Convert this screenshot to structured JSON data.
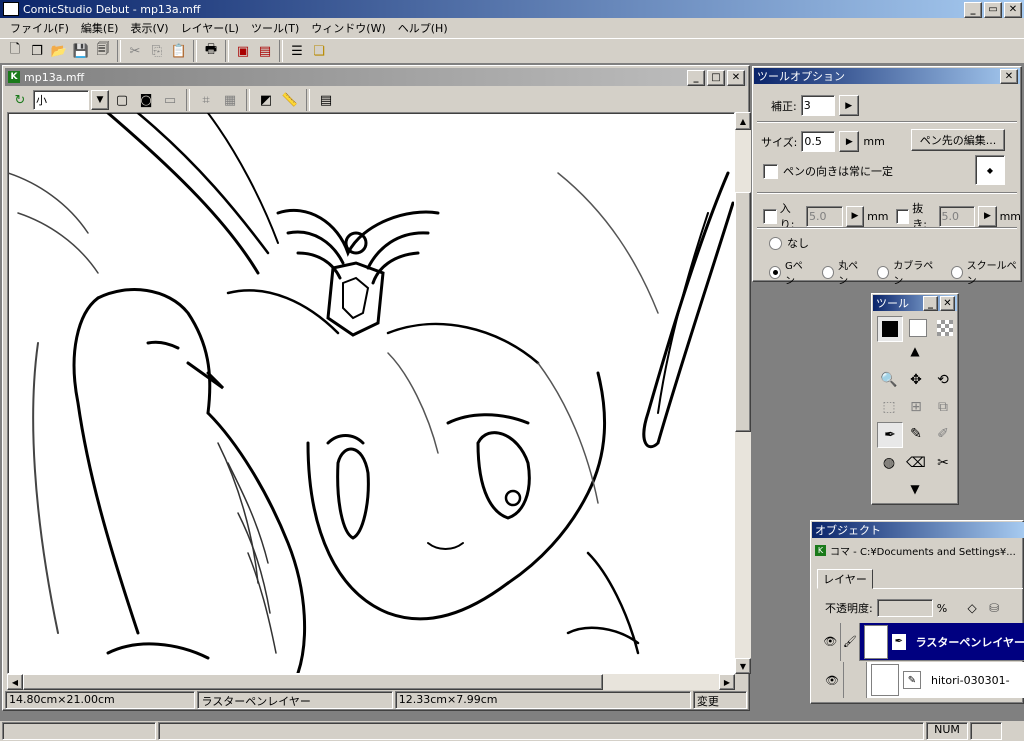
{
  "app": {
    "title": "ComicStudio Debut - mp13a.mff"
  },
  "menu": [
    "ファイル(F)",
    "編集(E)",
    "表示(V)",
    "レイヤー(L)",
    "ツール(T)",
    "ウィンドウ(W)",
    "ヘルプ(H)"
  ],
  "toolbar": {
    "icons": [
      "new-page-icon",
      "new-story-icon",
      "open-folder-icon",
      "save-icon",
      "save-all-icon",
      "cut-icon",
      "copy-icon",
      "paste-icon",
      "print-icon",
      "export-icon",
      "export-image-icon",
      "page-manager-icon",
      "story-icon"
    ]
  },
  "doc": {
    "title": "mp13a.mff",
    "zoom_value": "小",
    "status_size": "14.80cm×21.00cm",
    "status_layer": "ラスターペンレイヤー",
    "status_coord": "12.33cm×7.99cm",
    "status_changed": "変更"
  },
  "tool_options": {
    "title": "ツールオプション",
    "correction_label": "補正:",
    "correction_value": "3",
    "size_label": "サイズ:",
    "size_value": "0.5",
    "size_unit": "mm",
    "edit_tip_button": "ペン先の編集...",
    "fixed_direction_label": "ペンの向きは常に一定",
    "in_label": "入り:",
    "in_value": "5.0",
    "in_unit": "mm",
    "out_label": "抜き:",
    "out_value": "5.0",
    "out_unit": "mm",
    "pen_none": "なし",
    "pen_g": "Gペン",
    "pen_maru": "丸ペン",
    "pen_kabura": "カブラペン",
    "pen_school": "スクールペン"
  },
  "tools_panel": {
    "title": "ツール"
  },
  "object_panel": {
    "title": "オブジェクト",
    "path": "コマ - C:¥Documents and Settings¥...",
    "layer_tab": "レイヤー",
    "opacity_label": "不透明度:",
    "opacity_unit": "%",
    "layers": [
      {
        "name": "ラスターペンレイヤー",
        "selected": true
      },
      {
        "name": "hitori-030301-",
        "selected": false
      }
    ]
  },
  "statusbar": {
    "num": "NUM"
  }
}
